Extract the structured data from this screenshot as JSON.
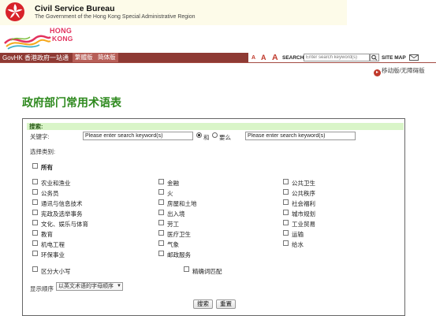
{
  "header": {
    "department": "Civil Service Bureau",
    "subtitle": "The Government of the Hong Kong Special Administrative Region",
    "brand_line1": "HONG",
    "brand_line2": "KONG"
  },
  "nav": {
    "govhk": "GovHK 香港政府一站通",
    "lang_tc": "繁體版",
    "lang_sc": "简体版",
    "font_small": "A",
    "font_medium": "A",
    "font_large": "A",
    "search_label": "SEARCH",
    "search_placeholder": "Enter search keyword(s)",
    "sitemap": "SITE MAP"
  },
  "mobile_link": "移动版/无障碍版",
  "page_title": "政府部门常用术语表",
  "form": {
    "heading": "搜索:",
    "keyword_label": "关键字:",
    "keyword_placeholder": "Please enter search keyword(s)",
    "and_label": "和",
    "or_label": "要么",
    "category_label": "选择类别:",
    "all_label": "所有",
    "categories": [
      "农业和渔业",
      "金融",
      "公共卫生",
      "公务员",
      "火",
      "公共秩序",
      "通讯与信息技术",
      "房屋和土地",
      "社会福利",
      "宪政及选举事务",
      "出入境",
      "城市规划",
      "文化、娱乐与体育",
      "劳工",
      "工业贸易",
      "教育",
      "医疗卫生",
      "运输",
      "机电工程",
      "气象",
      "给水",
      "环保事业",
      "邮政服务"
    ],
    "case_label": "区分大小写",
    "exact_label": "精确词匹配",
    "order_label": "显示顺序",
    "order_value": "以英文术语的字母顺序",
    "search_button": "搜索",
    "reset_button": "重置"
  },
  "colors": {
    "nav_bg": "#8e3a34",
    "title_green": "#2f8a1f",
    "panel_head_bg": "#d9f5c8",
    "accent_red": "#c0392b"
  }
}
